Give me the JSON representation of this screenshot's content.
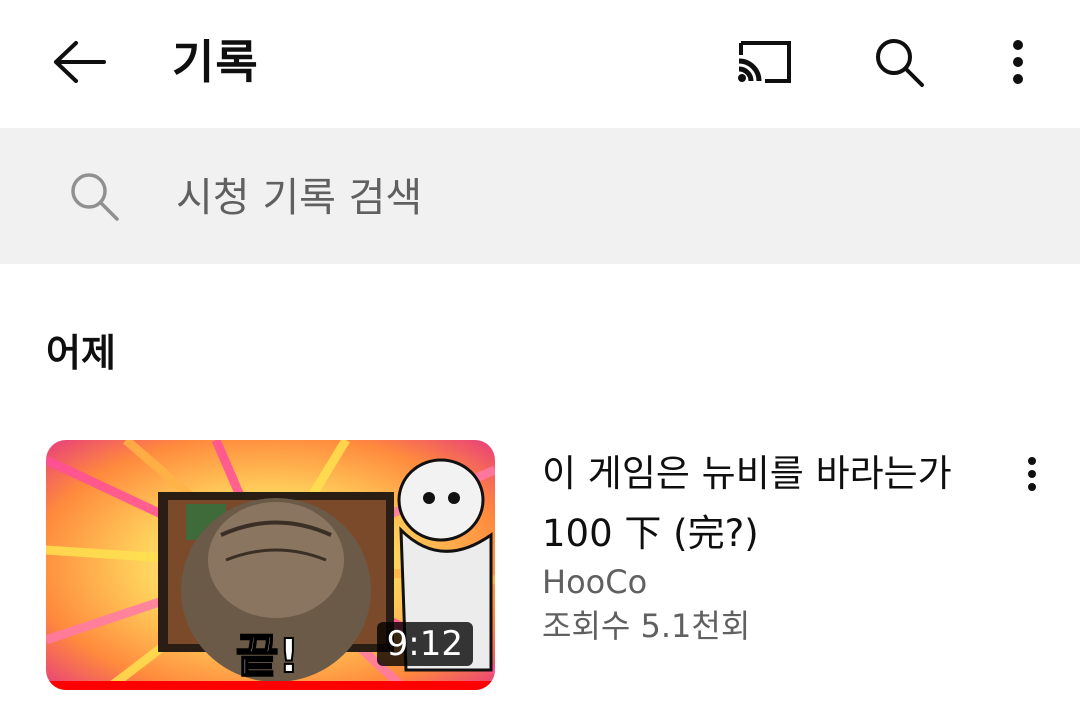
{
  "header": {
    "title": "기록",
    "back_icon": "arrow-left-icon",
    "cast_icon": "cast-icon",
    "search_icon": "search-icon",
    "more_icon": "more-vertical-icon"
  },
  "search": {
    "placeholder": "시청 기록 검색",
    "value": ""
  },
  "section_label": "어제",
  "videos": [
    {
      "title": "이 게임은 뉴비를 바라는가 100 下 (完?)",
      "channel": "HooCo",
      "views": "조회수 5.1천회",
      "duration": "9:12",
      "thumbnail_text": "끝!",
      "watched_fraction": 1.0
    }
  ],
  "colors": {
    "progress": "#ff0000",
    "search_bar_bg": "#f1f1f1",
    "secondary_text": "#606060"
  }
}
